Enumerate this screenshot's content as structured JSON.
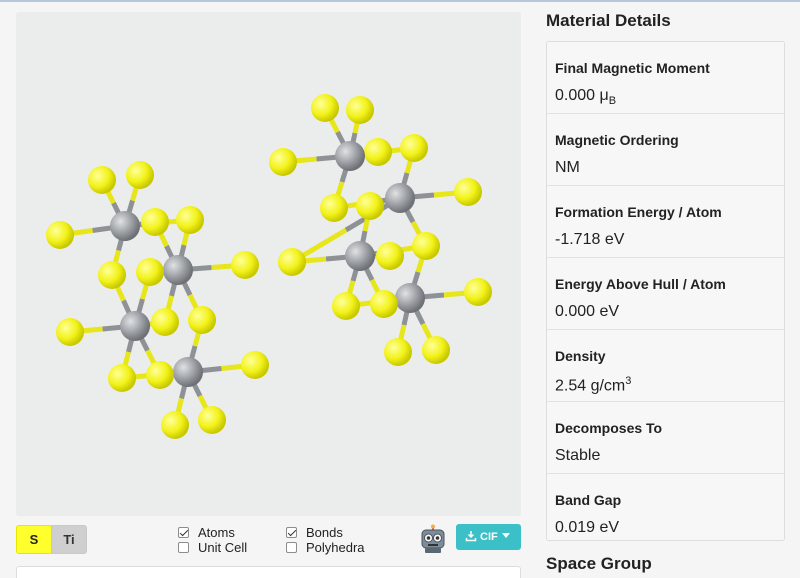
{
  "viewer": {
    "elements": [
      {
        "symbol": "S",
        "color": "#ffff2e"
      },
      {
        "symbol": "Ti",
        "color": "#cfcfcf"
      }
    ],
    "options": {
      "atoms": {
        "label": "Atoms",
        "checked": true
      },
      "unit_cell": {
        "label": "Unit Cell",
        "checked": false
      },
      "bonds": {
        "label": "Bonds",
        "checked": true
      },
      "polyhedra": {
        "label": "Polyhedra",
        "checked": false
      }
    },
    "download_label": "CIF",
    "colors": {
      "sulfur": "#f2f21a",
      "titanium": "#9a9ea3",
      "accent": "#3cc0c8"
    }
  },
  "sidebar": {
    "title": "Material Details",
    "details": [
      {
        "label": "Final Magnetic Moment",
        "value": "0.000 μ",
        "sub": "B"
      },
      {
        "label": "Magnetic Ordering",
        "value": "NM"
      },
      {
        "label": "Formation Energy / Atom",
        "value": "-1.718 eV"
      },
      {
        "label": "Energy Above Hull / Atom",
        "value": "0.000 eV"
      },
      {
        "label": "Density",
        "value": "2.54 g/cm",
        "sup": "3"
      },
      {
        "label": "Decomposes To",
        "value": "Stable"
      },
      {
        "label": "Band Gap",
        "value": "0.019 eV"
      }
    ],
    "next_section": "Space Group"
  }
}
